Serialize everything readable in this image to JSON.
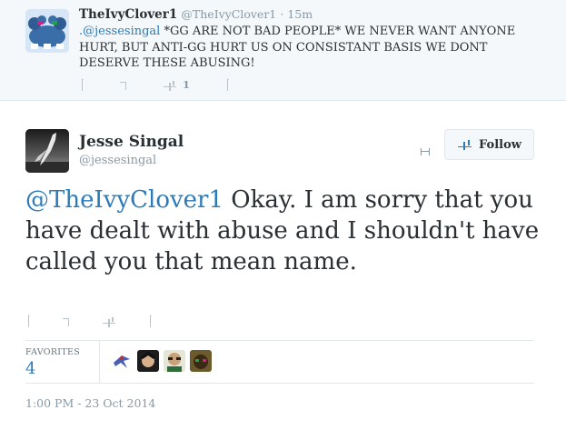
{
  "reply_tweet": {
    "name": "TheIvyClover1",
    "handle": "@TheIvyClover1",
    "time": "· 15m",
    "mention": ".@jessesingal",
    "text": " *GG ARE NOT BAD PEOPLE* WE NEVER WANT ANYONE HURT, BUT ANTI-GG HURT US ON CONSISTANT BASIS WE DONT DESERVE THESE ABUSING!",
    "retweet_count": "1"
  },
  "main_tweet": {
    "name": "Jesse Singal",
    "handle": "@jessesingal",
    "follow_label": "Follow",
    "mention": "@TheIvyClover1",
    "text": " Okay. I am sorry that you have dealt with abuse and I shouldn't have called you that mean name.",
    "favorites_label": "FAVORITES",
    "favorites_count": "4",
    "timestamp": "1:00 PM - 23 Oct 2014"
  },
  "colors": {
    "link": "#2b7bb9",
    "muted": "#8899a6",
    "text": "#292f33",
    "bar_bg": "#f5f8fa",
    "border": "#e1e8ed"
  },
  "icons": [
    "reply-icon",
    "retweet-icon",
    "favorite-icon",
    "more-icon",
    "follow-user-icon"
  ]
}
